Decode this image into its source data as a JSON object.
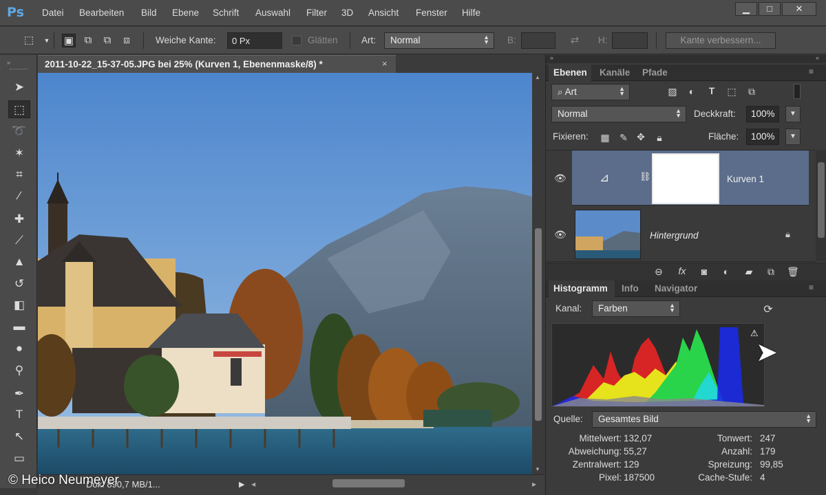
{
  "app": {
    "logo": "Ps"
  },
  "menu": [
    "Datei",
    "Bearbeiten",
    "Bild",
    "Ebene",
    "Schrift",
    "Auswahl",
    "Filter",
    "3D",
    "Ansicht",
    "Fenster",
    "Hilfe"
  ],
  "window_controls": {
    "minimize": "▁",
    "maximize": "□",
    "close": "✕"
  },
  "options": {
    "feather_label": "Weiche Kante:",
    "feather_value": "0 Px",
    "smooth_label": "Glätten",
    "style_label": "Art:",
    "style_value": "Normal",
    "width_label": "B:",
    "height_label": "H:",
    "refine_button": "Kante verbessern..."
  },
  "document": {
    "title": "2011-10-22_15-37-05.JPG bei 25% (Kurven 1, Ebenenmaske/8) *",
    "close": "×",
    "status": "Dok: 890,7 MB/1..."
  },
  "copyright": "© Heico Neumeyer",
  "layers_panel": {
    "tabs": [
      "Ebenen",
      "Kanäle",
      "Pfade"
    ],
    "filter_label": "Art",
    "blend_mode": "Normal",
    "opacity_label": "Deckkraft:",
    "opacity_value": "100%",
    "lock_label": "Fixieren:",
    "fill_label": "Fläche:",
    "fill_value": "100%",
    "layers": [
      {
        "name": "Kurven 1",
        "selected": true
      },
      {
        "name": "Hintergrund",
        "selected": false
      }
    ]
  },
  "histogram_panel": {
    "tabs": [
      "Histogramm",
      "Info",
      "Navigator"
    ],
    "channel_label": "Kanal:",
    "channel_value": "Farben",
    "source_label": "Quelle:",
    "source_value": "Gesamtes Bild",
    "stats_left": [
      {
        "label": "Mittelwert:",
        "value": "132,07"
      },
      {
        "label": "Abweichung:",
        "value": "55,27"
      },
      {
        "label": "Zentralwert:",
        "value": "129"
      },
      {
        "label": "Pixel:",
        "value": "187500"
      }
    ],
    "stats_right": [
      {
        "label": "Tonwert:",
        "value": "247"
      },
      {
        "label": "Anzahl:",
        "value": "179"
      },
      {
        "label": "Spreizung:",
        "value": "99,85"
      },
      {
        "label": "Cache-Stufe:",
        "value": "4"
      }
    ]
  },
  "colors": {
    "accent": "#5ea9e6",
    "selected_layer": "#5b6d8a",
    "panel_bg": "#3b3b3b"
  }
}
